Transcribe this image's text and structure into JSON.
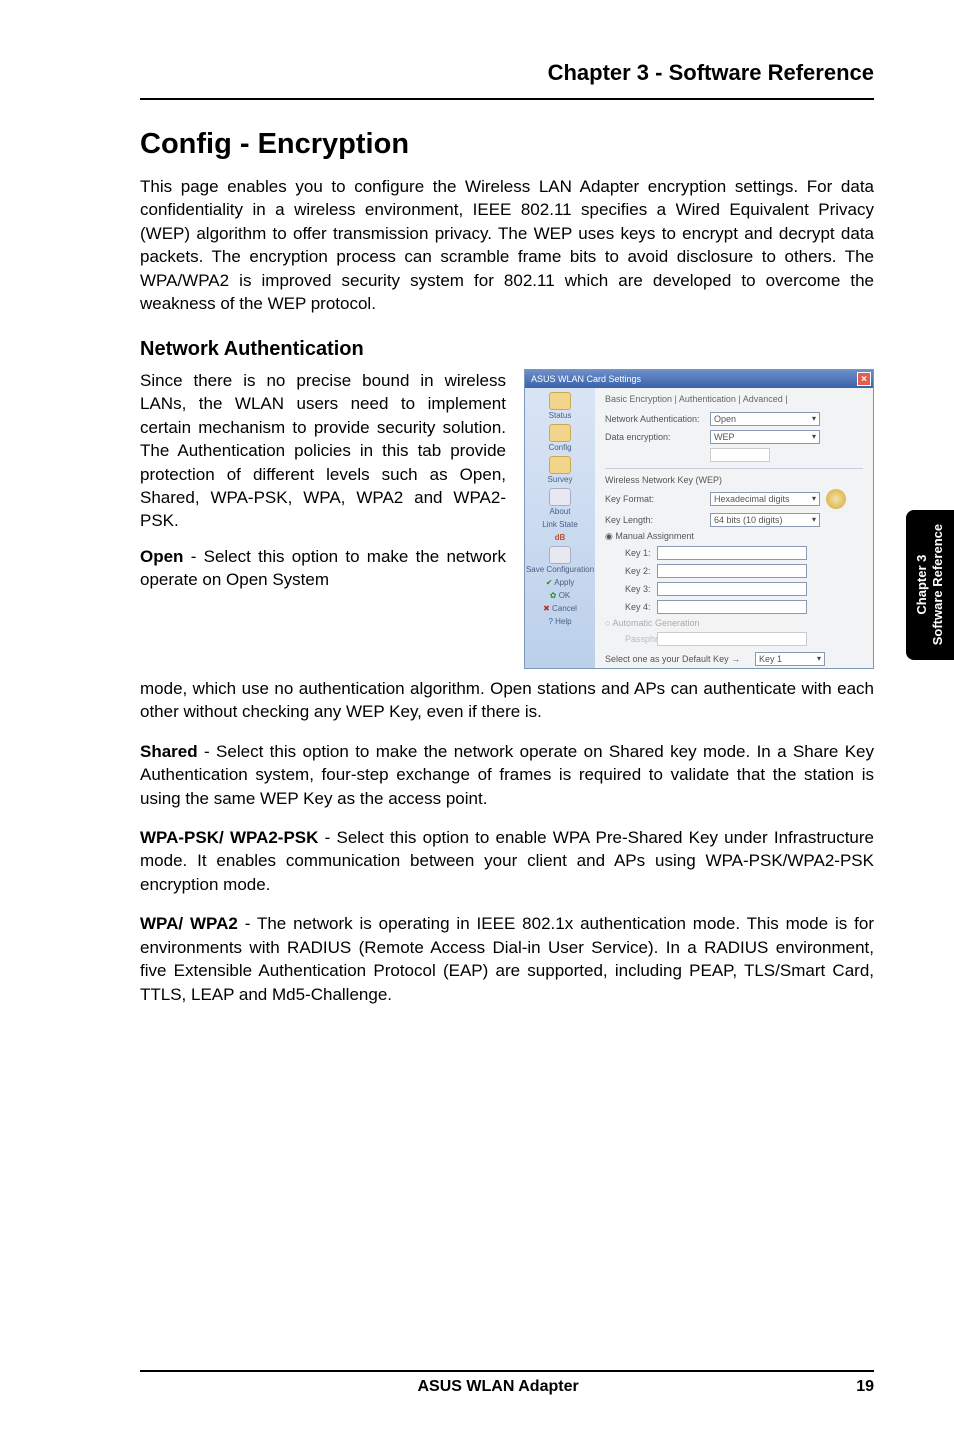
{
  "header": {
    "chapter_line": "Chapter 3 - Software Reference"
  },
  "title": "Config - Encryption",
  "intro": "This page enables you to configure the Wireless LAN Adapter encryption settings. For data confidentiality in a wireless environment, IEEE 802.11 specifies a Wired Equivalent Privacy (WEP) algorithm to offer transmission privacy. The WEP uses keys to encrypt and decrypt data packets. The encryption process can scramble frame bits to avoid disclosure to others. The WPA/WPA2  is improved security system for 802.11 which are developed to overcome the weakness of the WEP protocol.",
  "netauth": {
    "heading": "Network Authentication",
    "para1": "Since there is no precise bound in wireless LANs, the WLAN users need to implement certain mechanism to provide security solution. The Authentication policies in this tab provide protection of different levels such as Open, Shared, WPA-PSK, WPA, WPA2 and WPA2-PSK.",
    "open_lead": "Open",
    "open_text": " - Select this option to make the network operate on Open System ",
    "open_cont": "mode, which use no authentication algorithm. Open stations and APs can authenticate with each other without checking any WEP Key, even if there is."
  },
  "shared": {
    "lead": "Shared",
    "text": " - Select this option to make the network operate on Shared key mode. In a Share Key Authentication system, four-step exchange of frames is required to validate that the station is using the same WEP Key as the access point."
  },
  "wpapsk": {
    "lead": "WPA-PSK/ WPA2-PSK",
    "text": " - Select this option to enable WPA Pre-Shared Key under Infrastructure mode. It enables communication between your client and APs using WPA-PSK/WPA2-PSK encryption mode."
  },
  "wpa": {
    "lead": "WPA/ WPA2",
    "text": " - The network is operating in IEEE 802.1x authentication mode. This mode is for environments with RADIUS (Remote Access Dial-in User Service). In a RADIUS environment, five Extensible Authentication Protocol (EAP) are supported, including PEAP, TLS/Smart Card, TTLS, LEAP and Md5-Challenge."
  },
  "screenshot": {
    "window_title": "ASUS WLAN Card Settings",
    "tabs": "Basic   Encryption | Authentication | Advanced |",
    "side": {
      "status": "Status",
      "config": "Config",
      "survey": "Survey",
      "about": "About",
      "linkstate": "Link State",
      "signal": "dB",
      "saveconfig": "Save Configuration",
      "apply": "Apply",
      "ok": "OK",
      "cancel": "Cancel",
      "help": "Help"
    },
    "fields": {
      "netauth_label": "Network Authentication:",
      "netauth_value": "Open",
      "dataenc_label": "Data encryption:",
      "dataenc_value": "WEP",
      "wnk_label": "Wireless Network Key (WEP)",
      "keyformat_label": "Key Format:",
      "keyformat_value": "Hexadecimal digits",
      "keylen_label": "Key Length:",
      "keylen_value": "64 bits (10 digits)",
      "manual": "Manual Assignment",
      "key1": "Key 1:",
      "key2": "Key 2:",
      "key3": "Key 3:",
      "key4": "Key 4:",
      "autogen": "Automatic Generation",
      "passphrase": "Passphrase:",
      "default_label": "Select one as your Default Key →",
      "default_value": "Key 1"
    }
  },
  "sidetab": {
    "line1": "Chapter 3",
    "line2": "Software Reference"
  },
  "footer": {
    "center": "ASUS WLAN Adapter",
    "page": "19"
  }
}
